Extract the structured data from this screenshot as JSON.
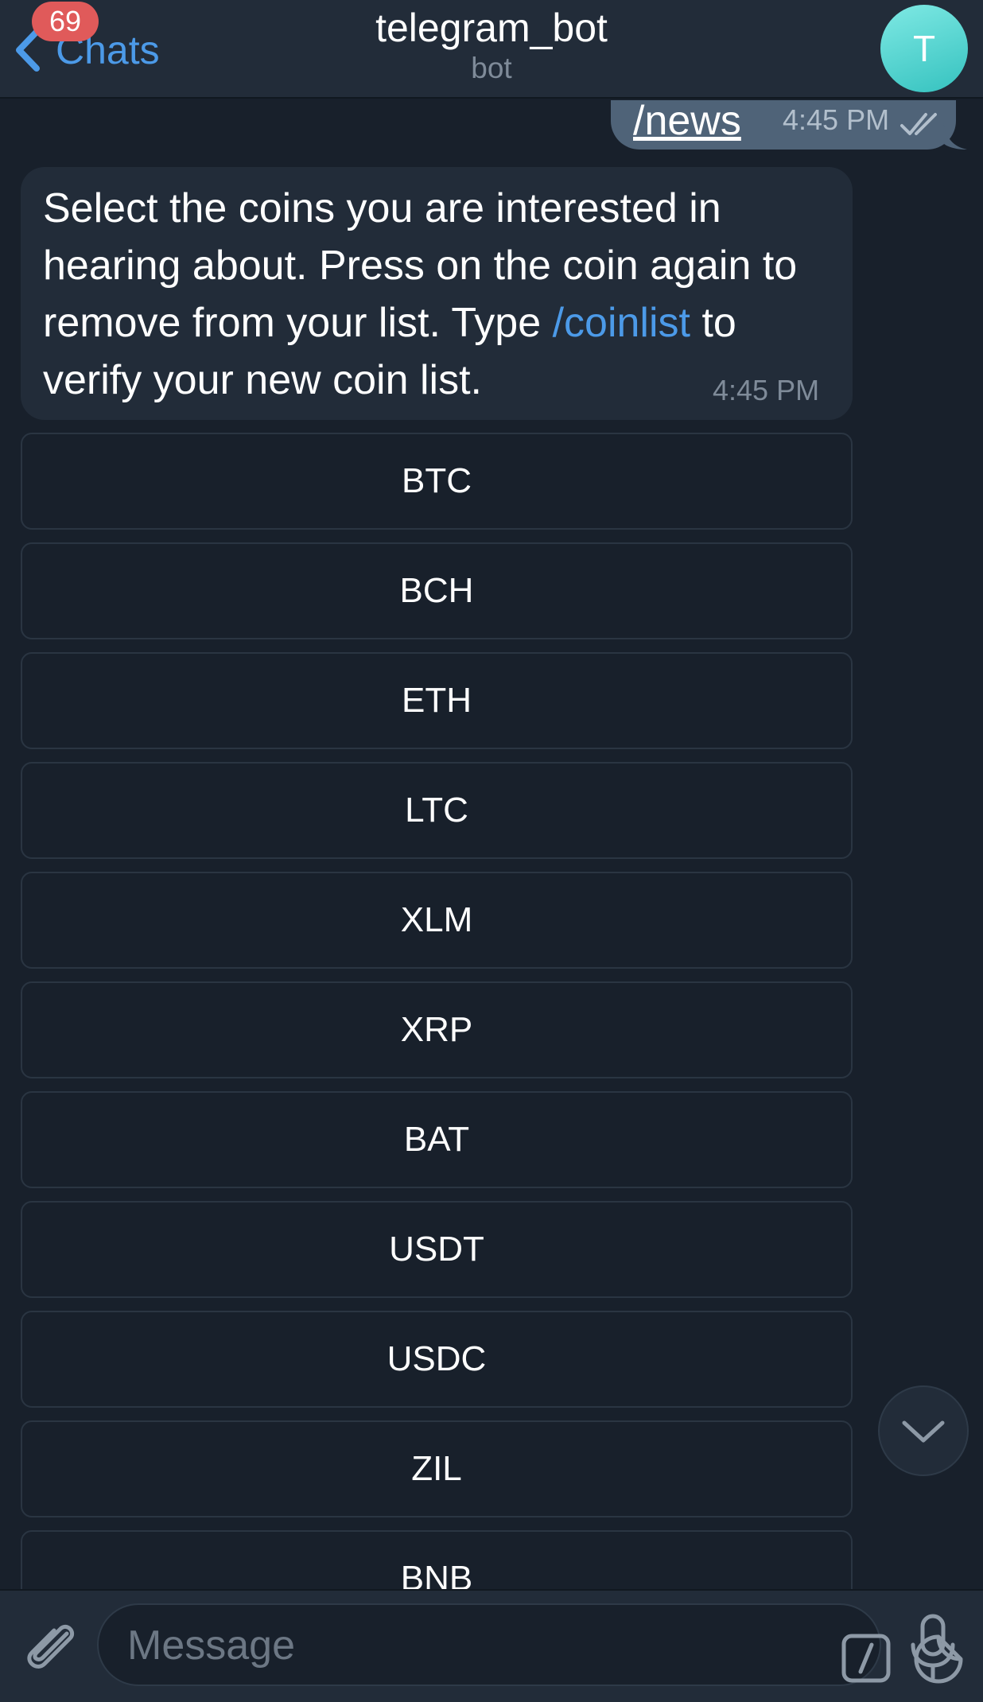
{
  "header": {
    "back_label": "Chats",
    "unread_count": "69",
    "title": "telegram_bot",
    "subtitle": "bot",
    "avatar_letter": "T",
    "avatar_color": "#4fd3cf"
  },
  "messages": {
    "outgoing": {
      "text": "/news",
      "time": "4:45 PM",
      "status": "read"
    },
    "incoming": {
      "text_before_link": "Select the coins you are interested in hearing about. Press on the coin again to remove from your list. Type ",
      "link": "/coinlist",
      "text_after_link": " to verify your new coin list.",
      "time": "4:45 PM"
    }
  },
  "inline_keyboard": [
    "BTC",
    "BCH",
    "ETH",
    "LTC",
    "XLM",
    "XRP",
    "BAT",
    "USDT",
    "USDC",
    "ZIL",
    "BNB"
  ],
  "composer": {
    "placeholder": "Message"
  },
  "icons": {
    "back": "chevron-left-icon",
    "attach": "paperclip-icon",
    "commands": "slash-command-icon",
    "sticker": "sticker-icon",
    "mic": "microphone-icon",
    "scroll_down": "chevron-down-icon"
  },
  "colors": {
    "accent": "#4c9ae8",
    "badge": "#e05a5a",
    "background": "#18202b",
    "bar": "#222c39"
  }
}
